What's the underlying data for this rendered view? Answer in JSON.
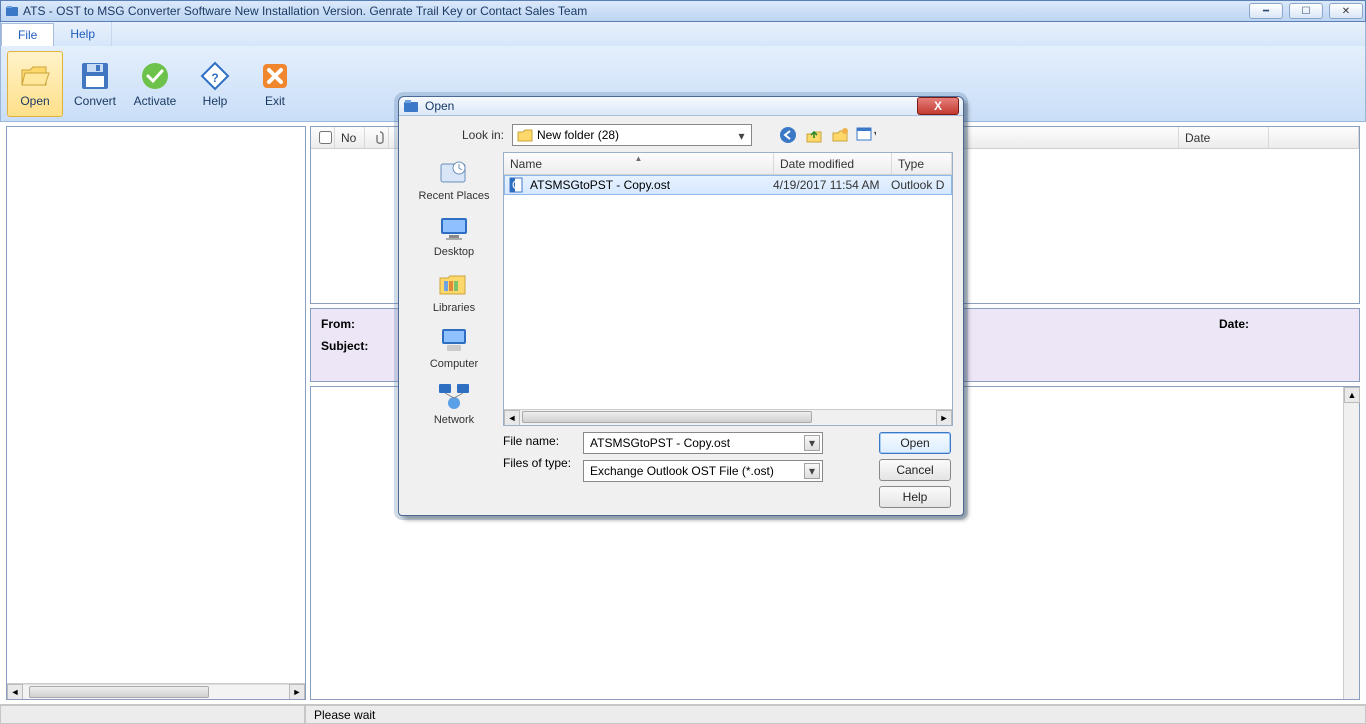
{
  "window": {
    "title": "ATS - OST to MSG Converter Software New Installation Version. Genrate Trail Key or Contact Sales Team"
  },
  "menubar": {
    "file": "File",
    "help": "Help"
  },
  "toolbar": {
    "open": "Open",
    "convert": "Convert",
    "activate": "Activate",
    "help": "Help",
    "exit": "Exit"
  },
  "list_headers": {
    "no": "No",
    "date": "Date"
  },
  "detail": {
    "from": "From:",
    "subject": "Subject:",
    "date": "Date:"
  },
  "statusbar": {
    "msg": "Please wait"
  },
  "dialog": {
    "title": "Open",
    "lookin_label": "Look in:",
    "lookin_value": "New folder (28)",
    "places": {
      "recent": "Recent Places",
      "desktop": "Desktop",
      "libraries": "Libraries",
      "computer": "Computer",
      "network": "Network"
    },
    "columns": {
      "name": "Name",
      "date_modified": "Date modified",
      "type": "Type"
    },
    "files": [
      {
        "name": "ATSMSGtoPST - Copy.ost",
        "date_modified": "4/19/2017 11:54 AM",
        "type": "Outlook D"
      }
    ],
    "filename_label": "File name:",
    "filename_value": "ATSMSGtoPST - Copy.ost",
    "filetype_label": "Files of type:",
    "filetype_value": "Exchange Outlook OST File (*.ost)",
    "open_btn": "Open",
    "cancel_btn": "Cancel",
    "help_btn": "Help"
  }
}
